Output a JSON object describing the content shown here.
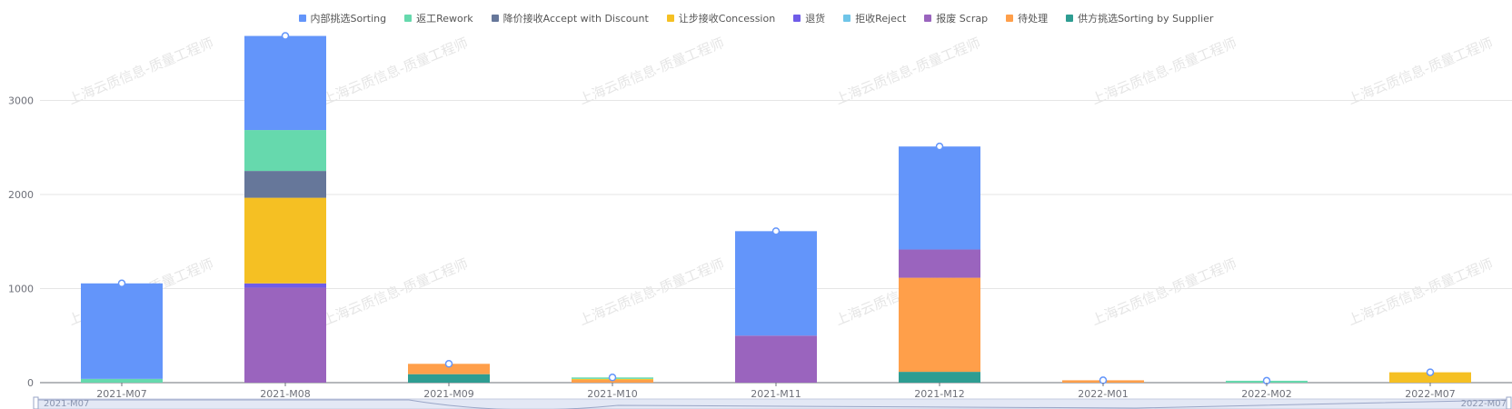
{
  "watermark": "上海云质信息-质量工程师",
  "slider": {
    "start_label": "2021-M07",
    "end_label": "2022-M07"
  },
  "chart_data": {
    "type": "bar",
    "stacked": true,
    "title": "",
    "xlabel": "",
    "ylabel": "",
    "ylim": [
      0,
      3700
    ],
    "yticks": [
      0,
      1000,
      2000,
      3000
    ],
    "grid": true,
    "legend_position": "top-center",
    "categories": [
      "2021-M07",
      "2021-M08",
      "2021-M09",
      "2021-M10",
      "2021-M11",
      "2021-M12",
      "2022-M01",
      "2022-M02",
      "2022-M07"
    ],
    "series": [
      {
        "name": "供方挑选Sorting by Supplier",
        "color": "#2e9d92",
        "values": [
          0,
          0,
          90,
          0,
          0,
          115,
          0,
          0,
          0
        ]
      },
      {
        "name": "待处理",
        "color": "#ff9f4a",
        "values": [
          0,
          0,
          110,
          30,
          0,
          1000,
          25,
          0,
          0
        ]
      },
      {
        "name": "报废 Scrap",
        "color": "#9a64be",
        "values": [
          0,
          1010,
          0,
          0,
          500,
          300,
          0,
          0,
          0
        ]
      },
      {
        "name": "拒收Reject",
        "color": "#6fc5e8",
        "values": [
          0,
          0,
          0,
          0,
          0,
          0,
          0,
          0,
          0
        ]
      },
      {
        "name": "退货",
        "color": "#6f5ce8",
        "values": [
          0,
          45,
          0,
          0,
          0,
          0,
          0,
          0,
          0
        ]
      },
      {
        "name": "让步接收Concession",
        "color": "#f5c023",
        "values": [
          0,
          910,
          0,
          10,
          0,
          0,
          0,
          0,
          110
        ]
      },
      {
        "name": "降价接收Accept with Discount",
        "color": "#66779a",
        "values": [
          0,
          285,
          0,
          0,
          0,
          0,
          0,
          0,
          0
        ]
      },
      {
        "name": "返工Rework",
        "color": "#66d9ad",
        "values": [
          40,
          435,
          0,
          15,
          0,
          0,
          0,
          20,
          0
        ]
      },
      {
        "name": "内部挑选Sorting",
        "color": "#6395fa",
        "values": [
          1015,
          1000,
          0,
          0,
          1110,
          1095,
          0,
          0,
          0
        ]
      }
    ],
    "legend_order": [
      "内部挑选Sorting",
      "返工Rework",
      "降价接收Accept with Discount",
      "让步接收Concession",
      "退货",
      "拒收Reject",
      "报废 Scrap",
      "待处理",
      "供方挑选Sorting by Supplier"
    ]
  }
}
